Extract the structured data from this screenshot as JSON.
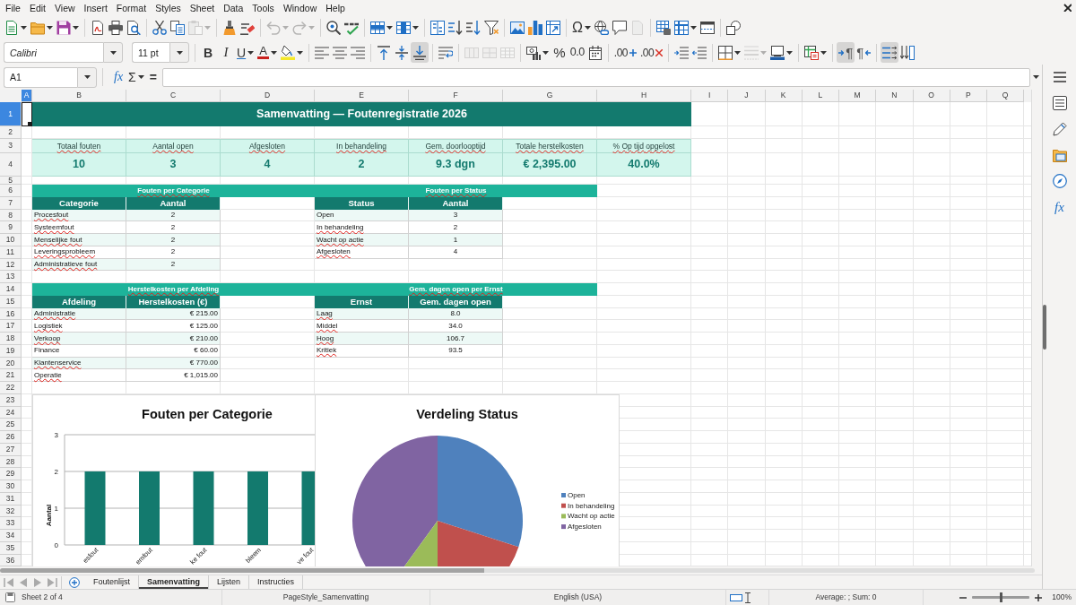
{
  "menu": [
    "File",
    "Edit",
    "View",
    "Insert",
    "Format",
    "Styles",
    "Sheet",
    "Data",
    "Tools",
    "Window",
    "Help"
  ],
  "toolbar_standard": [
    {
      "kind": "new",
      "dropdown": true,
      "disabled": false
    },
    {
      "kind": "open",
      "dropdown": true,
      "disabled": false
    },
    {
      "kind": "save",
      "dropdown": true,
      "disabled": false
    },
    {
      "kind": "separator"
    },
    {
      "kind": "pdf",
      "disabled": false
    },
    {
      "kind": "print",
      "disabled": false
    },
    {
      "kind": "preview",
      "disabled": false
    },
    {
      "kind": "separator"
    },
    {
      "kind": "cut",
      "disabled": false
    },
    {
      "kind": "copy",
      "disabled": false
    },
    {
      "kind": "paste",
      "dropdown": true,
      "disabled": true
    },
    {
      "kind": "separator"
    },
    {
      "kind": "clone",
      "disabled": false
    },
    {
      "kind": "clear",
      "disabled": false
    },
    {
      "kind": "separator"
    },
    {
      "kind": "undo",
      "dropdown": true,
      "disabled": true
    },
    {
      "kind": "redo",
      "dropdown": true,
      "disabled": true
    },
    {
      "kind": "separator"
    },
    {
      "kind": "find",
      "disabled": false
    },
    {
      "kind": "spelling",
      "disabled": false
    },
    {
      "kind": "separator"
    },
    {
      "kind": "rows",
      "dropdown": true,
      "disabled": false
    },
    {
      "kind": "columns",
      "dropdown": true,
      "disabled": false
    },
    {
      "kind": "separator"
    },
    {
      "kind": "sort",
      "disabled": false
    },
    {
      "kind": "sortup",
      "disabled": false
    },
    {
      "kind": "sortdown",
      "disabled": false
    },
    {
      "kind": "filter",
      "disabled": false
    },
    {
      "kind": "separator"
    },
    {
      "kind": "image",
      "disabled": false
    },
    {
      "kind": "chart",
      "disabled": false
    },
    {
      "kind": "pivot",
      "disabled": false
    },
    {
      "kind": "separator"
    },
    {
      "kind": "symbol",
      "text": "Ω",
      "dropdown": true,
      "disabled": false
    },
    {
      "kind": "link",
      "disabled": false
    },
    {
      "kind": "comment",
      "disabled": false
    },
    {
      "kind": "headers",
      "disabled": true
    },
    {
      "kind": "separator"
    },
    {
      "kind": "printarea",
      "disabled": false
    },
    {
      "kind": "freeze",
      "dropdown": true,
      "disabled": false
    },
    {
      "kind": "split",
      "disabled": false
    },
    {
      "kind": "separator"
    },
    {
      "kind": "draw",
      "disabled": false
    }
  ],
  "toolbar_formatting": {
    "font_name": "Calibri",
    "font_size": "11 pt",
    "items": [
      {
        "kind": "separator"
      },
      {
        "kind": "bold",
        "text": "B",
        "pressed": false,
        "disabled": false
      },
      {
        "kind": "italic",
        "text": "I",
        "pressed": false,
        "disabled": false
      },
      {
        "kind": "underline",
        "text": "U",
        "dropdown": true,
        "pressed": false,
        "disabled": false
      },
      {
        "kind": "fontcolor",
        "text": "A",
        "dropdown": true,
        "disabled": false
      },
      {
        "kind": "highlight",
        "dropdown": true,
        "disabled": false
      },
      {
        "kind": "separator"
      },
      {
        "kind": "alignleft",
        "pressed": false,
        "disabled": false
      },
      {
        "kind": "aligncenter",
        "pressed": false,
        "disabled": false
      },
      {
        "kind": "alignright",
        "pressed": false,
        "disabled": false
      },
      {
        "kind": "separator"
      },
      {
        "kind": "aligntop",
        "pressed": false,
        "disabled": false
      },
      {
        "kind": "alignmiddle",
        "pressed": false,
        "disabled": false
      },
      {
        "kind": "alignbottom",
        "pressed": true,
        "disabled": false
      },
      {
        "kind": "separator"
      },
      {
        "kind": "wrap",
        "pressed": false,
        "disabled": false
      },
      {
        "kind": "separator"
      },
      {
        "kind": "mergecenter",
        "pressed": false,
        "disabled": true
      },
      {
        "kind": "merge",
        "pressed": false,
        "disabled": true
      },
      {
        "kind": "unmerge",
        "pressed": false,
        "disabled": true
      },
      {
        "kind": "separator"
      },
      {
        "kind": "currency",
        "dropdown": true,
        "disabled": false
      },
      {
        "kind": "percent",
        "text": "%",
        "disabled": false
      },
      {
        "kind": "number",
        "text": "0.0",
        "disabled": false
      },
      {
        "kind": "date",
        "disabled": false
      },
      {
        "kind": "separator"
      },
      {
        "kind": "adddecimal",
        "text": ".00",
        "disabled": false
      },
      {
        "kind": "deldecimal",
        "text": ".00",
        "disabled": false
      },
      {
        "kind": "separator"
      },
      {
        "kind": "indent",
        "disabled": false
      },
      {
        "kind": "outdent",
        "disabled": false
      },
      {
        "kind": "separator"
      },
      {
        "kind": "borders",
        "dropdown": true,
        "disabled": false
      },
      {
        "kind": "borderstyle",
        "dropdown": true,
        "disabled": true
      },
      {
        "kind": "bordercolor",
        "dropdown": true,
        "disabled": false
      },
      {
        "kind": "separator"
      },
      {
        "kind": "conditional",
        "dropdown": true,
        "disabled": false
      },
      {
        "kind": "separator"
      },
      {
        "kind": "ltr",
        "text": "¶",
        "pressed": true,
        "disabled": false
      },
      {
        "kind": "rtl",
        "text": "¶",
        "pressed": false,
        "disabled": false
      },
      {
        "kind": "separator"
      },
      {
        "kind": "wraptext",
        "pressed": true,
        "disabled": false
      },
      {
        "kind": "stacked",
        "pressed": false,
        "disabled": false
      }
    ]
  },
  "formula_bar": {
    "name_box": "A1",
    "function_wizard": "fx",
    "sum": "Σ",
    "equals": "="
  },
  "sidebar": [
    {
      "kind": "properties"
    },
    {
      "kind": "styles"
    },
    {
      "kind": "gallery"
    },
    {
      "kind": "navigator"
    },
    {
      "kind": "functions",
      "text": "fx"
    }
  ],
  "sheet": {
    "columns": [
      {
        "label": "A",
        "selected": true
      },
      {
        "label": "B",
        "selected": false
      },
      {
        "label": "C",
        "selected": false
      },
      {
        "label": "D",
        "selected": false
      },
      {
        "label": "E",
        "selected": false
      },
      {
        "label": "F",
        "selected": false
      },
      {
        "label": "G",
        "selected": false
      },
      {
        "label": "H",
        "selected": false
      },
      {
        "label": "I",
        "selected": false
      },
      {
        "label": "J",
        "selected": false
      },
      {
        "label": "K",
        "selected": false
      },
      {
        "label": "L",
        "selected": false
      },
      {
        "label": "M",
        "selected": false
      },
      {
        "label": "N",
        "selected": false
      },
      {
        "label": "O",
        "selected": false
      },
      {
        "label": "P",
        "selected": false
      },
      {
        "label": "Q",
        "selected": false
      }
    ],
    "rows": [
      {
        "label": "1",
        "selected": true
      },
      {
        "label": "2",
        "selected": false
      },
      {
        "label": "3",
        "selected": false
      },
      {
        "label": "4",
        "selected": false
      },
      {
        "label": "5",
        "selected": false
      },
      {
        "label": "6",
        "selected": false
      },
      {
        "label": "7",
        "selected": false
      },
      {
        "label": "8",
        "selected": false
      },
      {
        "label": "9",
        "selected": false
      },
      {
        "label": "10",
        "selected": false
      },
      {
        "label": "11",
        "selected": false
      },
      {
        "label": "12",
        "selected": false
      },
      {
        "label": "13",
        "selected": false
      },
      {
        "label": "14",
        "selected": false
      },
      {
        "label": "15",
        "selected": false
      },
      {
        "label": "16",
        "selected": false
      },
      {
        "label": "17",
        "selected": false
      },
      {
        "label": "18",
        "selected": false
      },
      {
        "label": "19",
        "selected": false
      },
      {
        "label": "20",
        "selected": false
      },
      {
        "label": "21",
        "selected": false
      },
      {
        "label": "22",
        "selected": false
      },
      {
        "label": "23",
        "selected": false
      },
      {
        "label": "24",
        "selected": false
      },
      {
        "label": "25",
        "selected": false
      },
      {
        "label": "26",
        "selected": false
      },
      {
        "label": "27",
        "selected": false
      },
      {
        "label": "28",
        "selected": false
      },
      {
        "label": "29",
        "selected": false
      },
      {
        "label": "30",
        "selected": false
      },
      {
        "label": "31",
        "selected": false
      },
      {
        "label": "32",
        "selected": false
      },
      {
        "label": "33",
        "selected": false
      },
      {
        "label": "34",
        "selected": false
      },
      {
        "label": "35",
        "selected": false
      },
      {
        "label": "36",
        "selected": false
      }
    ],
    "title": "Samenvatting — Foutenregistratie 2026",
    "kpis": [
      {
        "label": "Totaal fouten",
        "value": "10",
        "misspelled": true
      },
      {
        "label": "Aantal open",
        "value": "3",
        "misspelled": true
      },
      {
        "label": "Afgesloten",
        "value": "4",
        "misspelled": true
      },
      {
        "label": "In behandeling",
        "value": "2",
        "misspelled": true
      },
      {
        "label": "Gem. doorlooptijd",
        "value": "9.3 dgn",
        "misspelled": true
      },
      {
        "label": "Totale herstelkosten",
        "value": "€ 2,395.00",
        "misspelled": true
      },
      {
        "label": "% Op tijd opgelost",
        "value": "40.0%",
        "misspelled": true
      }
    ],
    "tables": [
      {
        "kind": "count",
        "title": "Fouten per Categorie",
        "title_misspelled": true,
        "headers": [
          "Categorie",
          "Aantal"
        ],
        "rows": [
          {
            "label": "Procesfout",
            "value": "2",
            "misspelled": true
          },
          {
            "label": "Systeemfout",
            "value": "2",
            "misspelled": true
          },
          {
            "label": "Menselijke fout",
            "value": "2",
            "misspelled": true
          },
          {
            "label": "Leveringsprobleem",
            "value": "2",
            "misspelled": true
          },
          {
            "label": "Administratieve fout",
            "value": "2",
            "misspelled": true
          }
        ]
      },
      {
        "kind": "count",
        "title": "Fouten per Status",
        "title_misspelled": true,
        "headers": [
          "Status",
          "Aantal"
        ],
        "rows": [
          {
            "label": "Open",
            "value": "3",
            "misspelled": false
          },
          {
            "label": "In behandeling",
            "value": "2",
            "misspelled": true
          },
          {
            "label": "Wacht op actie",
            "value": "1",
            "misspelled": true
          },
          {
            "label": "Afgesloten",
            "value": "4",
            "misspelled": true
          }
        ]
      },
      {
        "kind": "currency",
        "title": "Herstelkosten per Afdeling",
        "title_misspelled": true,
        "headers": [
          "Afdeling",
          "Herstelkosten (€)"
        ],
        "rows": [
          {
            "label": "Administratie",
            "value": "€ 215.00",
            "misspelled": true
          },
          {
            "label": "Logistiek",
            "value": "€ 125.00",
            "misspelled": true
          },
          {
            "label": "Verkoop",
            "value": "€ 210.00",
            "misspelled": true
          },
          {
            "label": "Finance",
            "value": "€ 60.00",
            "misspelled": false
          },
          {
            "label": "Klantenservice",
            "value": "€ 770.00",
            "misspelled": true
          },
          {
            "label": "Operatie",
            "value": "€ 1,015.00",
            "misspelled": true
          }
        ]
      },
      {
        "kind": "average",
        "title": "Gem. dagen open per Ernst",
        "title_misspelled": true,
        "headers": [
          "Ernst",
          "Gem. dagen open"
        ],
        "rows": [
          {
            "label": "Laag",
            "value": "8.0",
            "misspelled": true
          },
          {
            "label": "Middel",
            "value": "34.0",
            "misspelled": true
          },
          {
            "label": "Hoog",
            "value": "106.7",
            "misspelled": true
          },
          {
            "label": "Kritiek",
            "value": "93.5",
            "misspelled": true
          }
        ]
      }
    ],
    "charts": [
      {
        "chart_data": {
          "type": "bar",
          "title": "Fouten per Categorie",
          "ylabel": "Aantal",
          "categories": [
            "esfout",
            "emfout",
            "ke fout",
            "bleem",
            "ve fout"
          ],
          "series": [
            {
              "color": "#137a6e",
              "values": [
                2,
                2,
                2,
                2,
                2
              ]
            }
          ],
          "ylim": [
            0,
            3
          ],
          "yticks": [
            0,
            1,
            2,
            3
          ]
        }
      },
      {
        "chart_data": {
          "type": "pie",
          "title": "Verdeling Status",
          "categories": [
            "Open",
            "In behandeling",
            "Wacht op actie",
            "Afgesloten"
          ],
          "values": [
            30,
            20,
            10,
            40
          ],
          "legend": "right"
        },
        "slices": [
          {
            "color": "#4f81bd"
          },
          {
            "color": "#c0504d"
          },
          {
            "color": "#9bbb59"
          },
          {
            "color": "#8064a2"
          }
        ]
      }
    ]
  },
  "sheet_tabs": [
    {
      "label": "Foutenlijst",
      "selected": false
    },
    {
      "label": "Samenvatting",
      "selected": true
    },
    {
      "label": "Lijsten",
      "selected": false
    },
    {
      "label": "Instructies",
      "selected": false
    }
  ],
  "status_bar": {
    "sheet": "Sheet 2 of 4",
    "page_style": "PageStyle_Samenvatting",
    "language": "English (USA)",
    "summary": "Average: ; Sum: 0",
    "zoom": {
      "level": 0.5,
      "percent": "100%"
    }
  }
}
